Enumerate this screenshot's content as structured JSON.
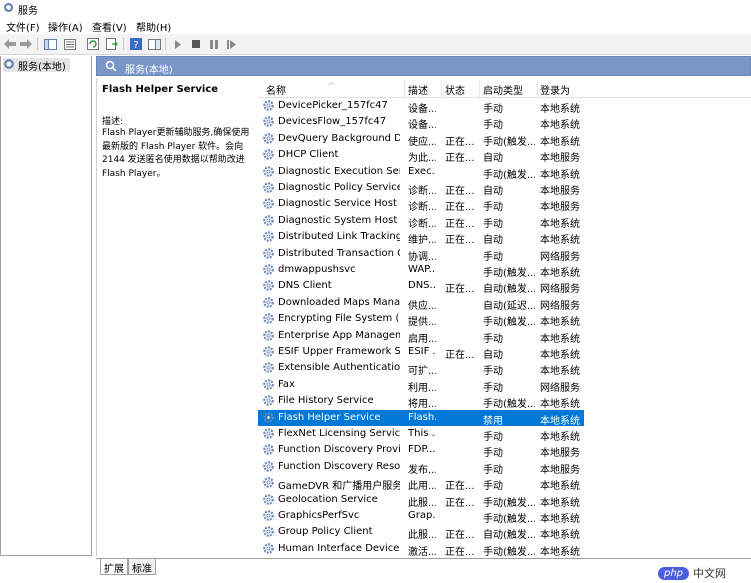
{
  "window": {
    "title": "服务"
  },
  "menu": [
    "文件(F)",
    "操作(A)",
    "查看(V)",
    "帮助(H)"
  ],
  "tree": {
    "item": "服务(本地)"
  },
  "pane": {
    "header": "服务(本地)"
  },
  "detail": {
    "service_name": "Flash Helper Service",
    "description_label": "描述:",
    "description": "Flash Player更新辅助服务,确保使用最新版的 Flash Player 软件。会向 2144 发送匿名使用数据以帮助改进 Flash Player。"
  },
  "table": {
    "headers": [
      "名称",
      "描述",
      "状态",
      "启动类型",
      "登录为"
    ],
    "rows": [
      {
        "name": "DevicePicker_157fc47",
        "desc": "设备...",
        "status": "",
        "startup": "手动",
        "logon": "本地系统"
      },
      {
        "name": "DevicesFlow_157fc47",
        "desc": "设备...",
        "status": "",
        "startup": "手动",
        "logon": "本地系统"
      },
      {
        "name": "DevQuery Background Dis...",
        "desc": "使应...",
        "status": "正在...",
        "startup": "手动(触发...",
        "logon": "本地系统"
      },
      {
        "name": "DHCP Client",
        "desc": "为此...",
        "status": "正在...",
        "startup": "自动",
        "logon": "本地服务"
      },
      {
        "name": "Diagnostic Execution Service",
        "desc": "Exec...",
        "status": "",
        "startup": "手动(触发...",
        "logon": "本地系统"
      },
      {
        "name": "Diagnostic Policy Service",
        "desc": "诊断...",
        "status": "正在...",
        "startup": "自动",
        "logon": "本地服务"
      },
      {
        "name": "Diagnostic Service Host",
        "desc": "诊断...",
        "status": "正在...",
        "startup": "手动",
        "logon": "本地服务"
      },
      {
        "name": "Diagnostic System Host",
        "desc": "诊断...",
        "status": "正在...",
        "startup": "手动",
        "logon": "本地系统"
      },
      {
        "name": "Distributed Link Tracking C...",
        "desc": "维护...",
        "status": "正在...",
        "startup": "自动",
        "logon": "本地系统"
      },
      {
        "name": "Distributed Transaction Co...",
        "desc": "协调...",
        "status": "",
        "startup": "手动",
        "logon": "网络服务"
      },
      {
        "name": "dmwappushsvc",
        "desc": "WAP...",
        "status": "",
        "startup": "手动(触发...",
        "logon": "本地系统"
      },
      {
        "name": "DNS Client",
        "desc": "DNS...",
        "status": "正在...",
        "startup": "自动(触发...",
        "logon": "网络服务"
      },
      {
        "name": "Downloaded Maps Manager",
        "desc": "供应...",
        "status": "",
        "startup": "自动(延迟...",
        "logon": "网络服务"
      },
      {
        "name": "Encrypting File System (EFS)",
        "desc": "提供...",
        "status": "",
        "startup": "手动(触发...",
        "logon": "本地系统"
      },
      {
        "name": "Enterprise App Manageme...",
        "desc": "启用...",
        "status": "",
        "startup": "手动",
        "logon": "本地系统"
      },
      {
        "name": "ESIF Upper Framework Ser...",
        "desc": "ESIF ...",
        "status": "正在...",
        "startup": "自动",
        "logon": "本地系统"
      },
      {
        "name": "Extensible Authentication ...",
        "desc": "可扩...",
        "status": "",
        "startup": "手动",
        "logon": "本地系统"
      },
      {
        "name": "Fax",
        "desc": "利用...",
        "status": "",
        "startup": "手动",
        "logon": "网络服务"
      },
      {
        "name": "File History Service",
        "desc": "将用...",
        "status": "",
        "startup": "手动(触发...",
        "logon": "本地系统"
      },
      {
        "name": "Flash Helper Service",
        "desc": "Flash...",
        "status": "",
        "startup": "禁用",
        "logon": "本地系统"
      },
      {
        "name": "FlexNet Licensing Service",
        "desc": "This ...",
        "status": "",
        "startup": "手动",
        "logon": "本地系统"
      },
      {
        "name": "Function Discovery Provide...",
        "desc": "FDP...",
        "status": "",
        "startup": "手动",
        "logon": "本地服务"
      },
      {
        "name": "Function Discovery Resour...",
        "desc": "发布...",
        "status": "",
        "startup": "手动",
        "logon": "本地服务"
      },
      {
        "name": "GameDVR 和广播用户服务...",
        "desc": "此用...",
        "status": "正在...",
        "startup": "手动",
        "logon": "本地系统"
      },
      {
        "name": "Geolocation Service",
        "desc": "此服...",
        "status": "正在...",
        "startup": "手动(触发...",
        "logon": "本地系统"
      },
      {
        "name": "GraphicsPerfSvc",
        "desc": "Grap...",
        "status": "",
        "startup": "手动(触发...",
        "logon": "本地系统"
      },
      {
        "name": "Group Policy Client",
        "desc": "此服...",
        "status": "正在...",
        "startup": "自动(触发...",
        "logon": "本地系统"
      },
      {
        "name": "Human Interface Device S...",
        "desc": "激活...",
        "status": "正在...",
        "startup": "手动(触发...",
        "logon": "本地系统"
      }
    ],
    "selected_index": 19
  },
  "tabs": [
    "扩展",
    "标准"
  ],
  "watermark": {
    "badge": "php",
    "text": "中文网"
  },
  "colors": {
    "selection": "#0078d7",
    "pane_header": "#7a96c8"
  }
}
